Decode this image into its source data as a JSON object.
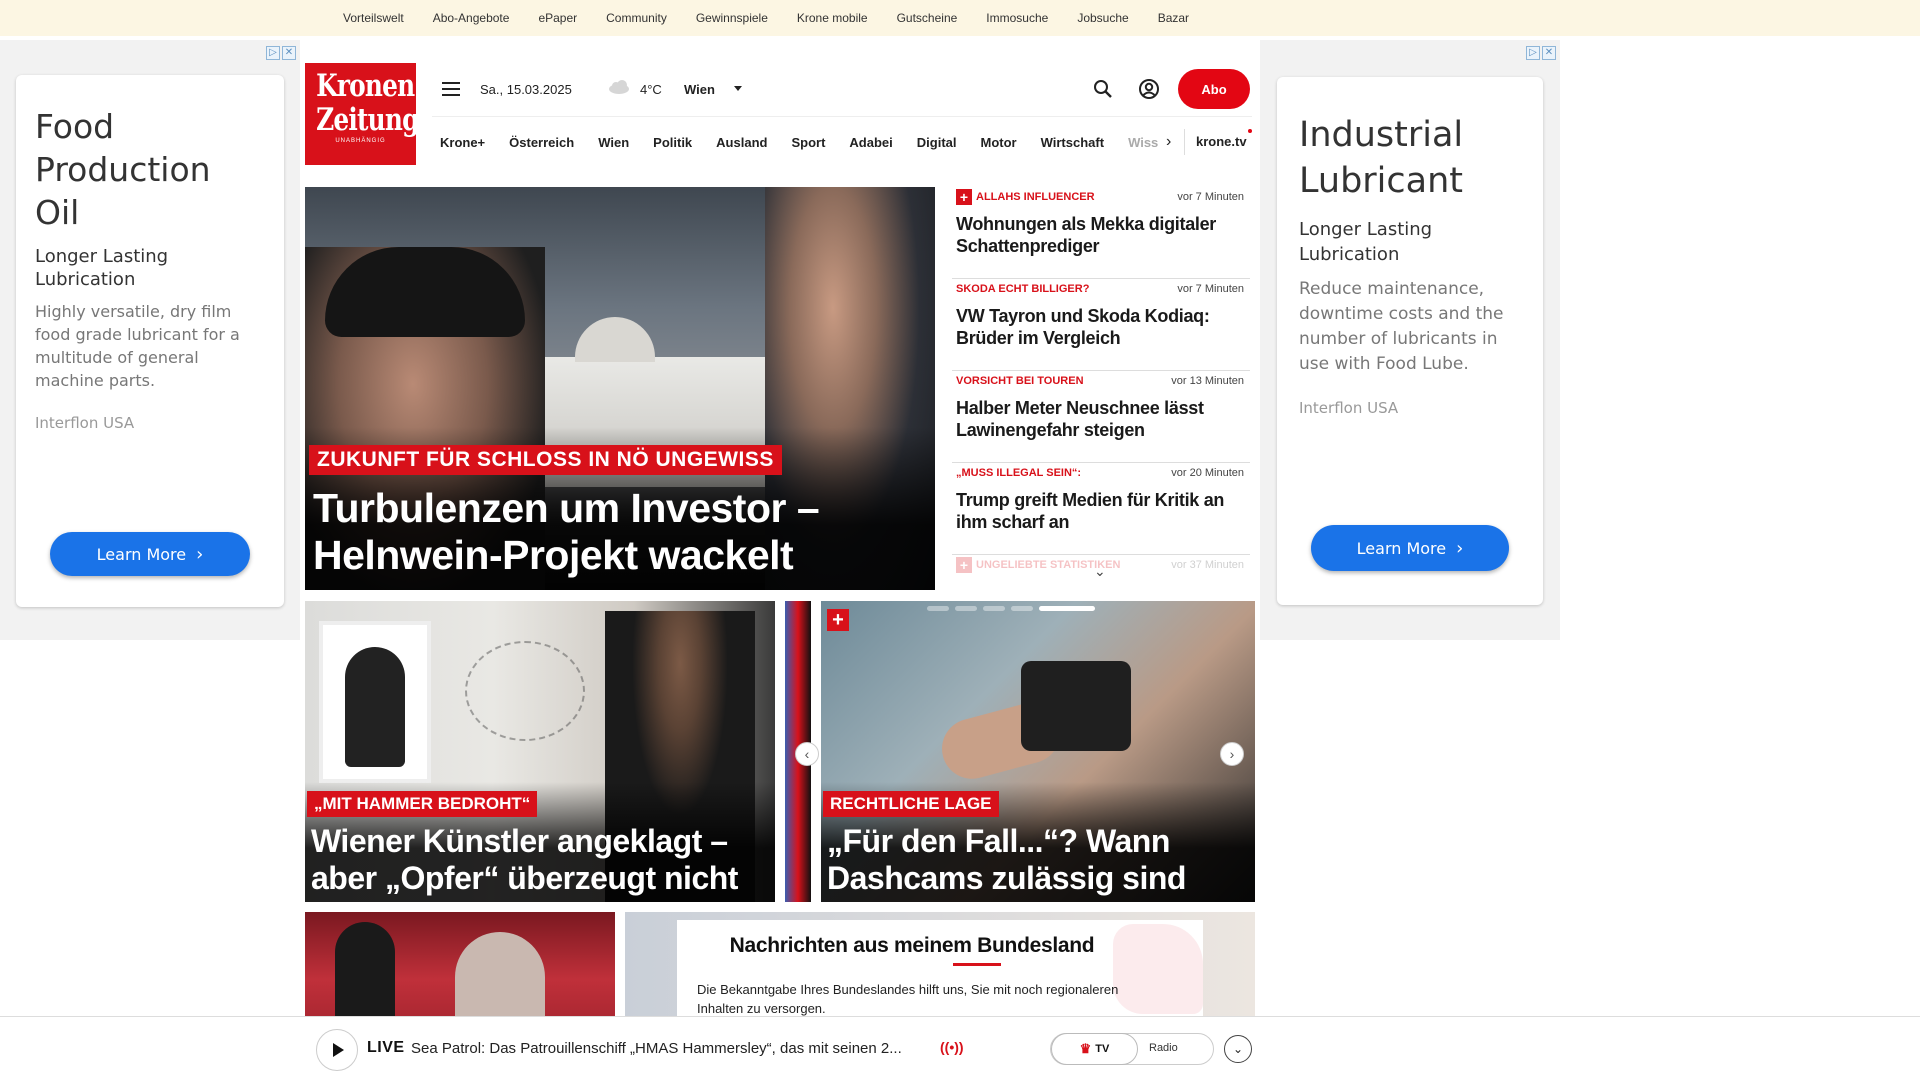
{
  "topbar": {
    "links": [
      "Vorteilswelt",
      "Abo-Angebote",
      "ePaper",
      "Community",
      "Gewinnspiele",
      "Krone mobile",
      "Gutscheine",
      "Immosuche",
      "Jobsuche",
      "Bazar"
    ]
  },
  "ad_left": {
    "title": "Food Production Oil",
    "title_lines": [
      "Food",
      "Production",
      "Oil"
    ],
    "sub_lines": [
      "Longer Lasting",
      "Lubrication"
    ],
    "desc_lines": [
      "Highly versatile, dry film",
      "food grade lubricant for a",
      "multitude of general",
      "machine parts."
    ],
    "advertiser": "Interflon USA",
    "cta": "Learn More"
  },
  "ad_right": {
    "title_lines": [
      "Industrial",
      "Lubricant"
    ],
    "sub_lines": [
      "Longer Lasting",
      "Lubrication"
    ],
    "desc_lines": [
      "Reduce maintenance,",
      "downtime costs and the",
      "number of lubricants in",
      "use with Food Lube."
    ],
    "advertiser": "Interflon USA",
    "cta": "Learn More"
  },
  "logo": {
    "line1": "Kronen",
    "line2": "Zeitung",
    "line3": "UNABHÄNGIG"
  },
  "header": {
    "date": "Sa., 15.03.2025",
    "temperature": "4°C",
    "city": "Wien",
    "abo_label": "Abo"
  },
  "nav": {
    "items": [
      "Krone+",
      "Österreich",
      "Wien",
      "Politik",
      "Ausland",
      "Sport",
      "Adabei",
      "Digital",
      "Motor",
      "Wirtschaft"
    ],
    "faded": "Wiss",
    "tv": "krone.tv"
  },
  "hero": {
    "kicker": "ZUKUNFT FÜR SCHLOSS IN NÖ UNGEWISS",
    "title_line1": "Turbulenzen um Investor –",
    "title_line2": "Helnwein-Projekt wackelt"
  },
  "news": [
    {
      "kicker": "ALLAHS INFLUENCER",
      "plus": true,
      "time": "vor 7 Minuten",
      "title": "Wohnungen als Mekka digitaler Schattenprediger"
    },
    {
      "kicker": "SKODA ECHT BILLIGER?",
      "plus": false,
      "time": "vor 7 Minuten",
      "title": "VW Tayron und Skoda Kodiaq: Brüder im Vergleich"
    },
    {
      "kicker": "VORSICHT BEI TOUREN",
      "plus": false,
      "time": "vor 13 Minuten",
      "title": "Halber Meter Neuschnee lässt Lawinengefahr steigen"
    },
    {
      "kicker": "„MUSS ILLEGAL SEIN“:",
      "plus": false,
      "time": "vor 20 Minuten",
      "title": "Trump greift Medien für Kritik an ihm scharf an"
    },
    {
      "kicker": "UNGELIEBTE STATISTIKEN",
      "plus": true,
      "time": "vor 37 Minuten",
      "title": ""
    }
  ],
  "card_left": {
    "kicker": "„MIT HAMMER BEDROHT“",
    "title_line1": "Wiener Künstler angeklagt –",
    "title_line2": "aber „Opfer“ überzeugt nicht"
  },
  "card_right": {
    "kicker": "RECHTLICHE LAGE",
    "title_line1": "„Für den Fall...“? Wann",
    "title_line2": "Dashcams zulässig sind"
  },
  "bundesland": {
    "title": "Nachrichten aus meinem Bundesland",
    "text": "Die Bekanntgabe Ihres Bundeslandes hilft uns, Sie mit noch regionaleren Inhalten zu versorgen."
  },
  "player": {
    "live": "LIVE",
    "text": "Sea Patrol: Das Patrouillenschiff „HMAS Hammersley“, das mit seinen 2...",
    "tv": "TV",
    "radio": "Radio"
  },
  "colors": {
    "brand_red": "#d8111a",
    "ad_blue": "#1a73e8",
    "topbar_bg": "#fcf6e3"
  }
}
